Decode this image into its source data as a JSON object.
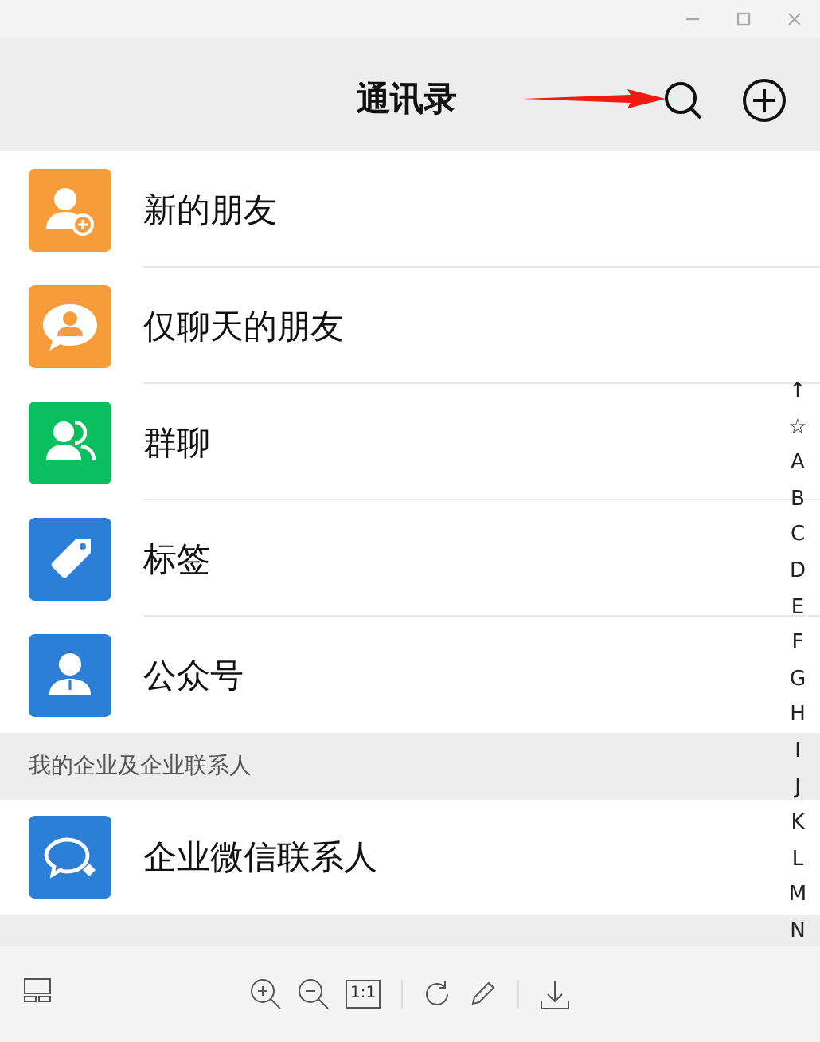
{
  "header": {
    "title": "通讯录"
  },
  "items": [
    {
      "label": "新的朋友",
      "kind": "new-friend",
      "color": "#f79c3a"
    },
    {
      "label": "仅聊天的朋友",
      "kind": "chat-only",
      "color": "#f79c3a"
    },
    {
      "label": "群聊",
      "kind": "group",
      "color": "#0bbf5f"
    },
    {
      "label": "标签",
      "kind": "tag",
      "color": "#2c7fd6"
    },
    {
      "label": "公众号",
      "kind": "official",
      "color": "#2c7fd6"
    }
  ],
  "section": {
    "title": "我的企业及企业联系人",
    "items": [
      {
        "label": "企业微信联系人",
        "kind": "work",
        "color": "#2c7fd6"
      }
    ]
  },
  "index": [
    "↑",
    "☆",
    "A",
    "B",
    "C",
    "D",
    "E",
    "F",
    "G",
    "H",
    "I",
    "J",
    "K",
    "L",
    "M",
    "N"
  ],
  "toolbar": {
    "actual_size": "1:1"
  }
}
